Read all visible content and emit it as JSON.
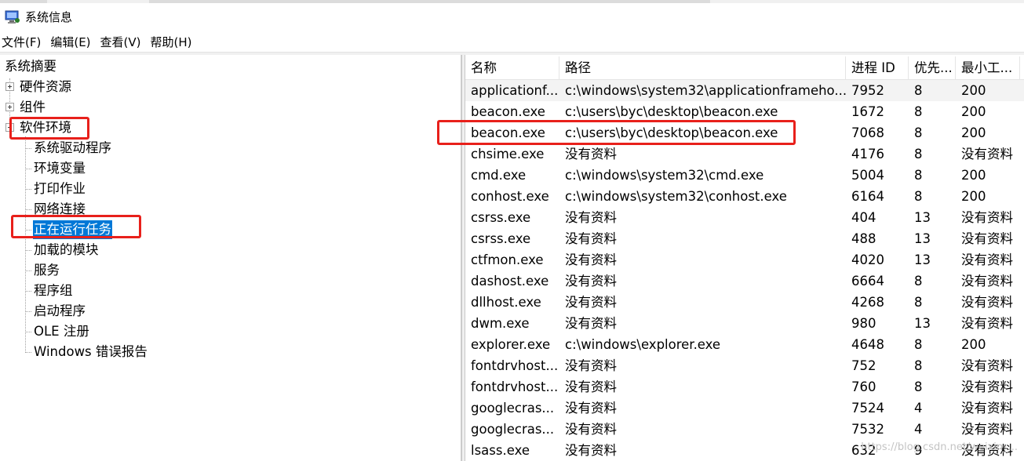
{
  "window": {
    "title": "系统信息",
    "app_icon": "system-info-icon"
  },
  "menu": [
    "文件(F)",
    "编辑(E)",
    "查看(V)",
    "帮助(H)"
  ],
  "tree": {
    "root": "系统摘要",
    "items": [
      {
        "label": "硬件资源",
        "expandable": true
      },
      {
        "label": "组件",
        "expandable": true
      },
      {
        "label": "软件环境",
        "expandable": true
      }
    ],
    "software_children": [
      "系统驱动程序",
      "环境变量",
      "打印作业",
      "网络连接",
      "正在运行任务",
      "加载的模块",
      "服务",
      "程序组",
      "启动程序",
      "OLE 注册",
      "Windows 错误报告"
    ],
    "selected": "正在运行任务"
  },
  "table": {
    "columns": [
      "名称",
      "路径",
      "进程 ID",
      "优先...",
      "最小工..."
    ],
    "rows": [
      [
        "applicationf...",
        "c:\\windows\\system32\\applicationframeho...",
        "7952",
        "8",
        "200"
      ],
      [
        "beacon.exe",
        "c:\\users\\byc\\desktop\\beacon.exe",
        "1672",
        "8",
        "200"
      ],
      [
        "beacon.exe",
        "c:\\users\\byc\\desktop\\beacon.exe",
        "7068",
        "8",
        "200"
      ],
      [
        "chsime.exe",
        "没有资料",
        "4176",
        "8",
        "没有资料"
      ],
      [
        "cmd.exe",
        "c:\\windows\\system32\\cmd.exe",
        "5004",
        "8",
        "200"
      ],
      [
        "conhost.exe",
        "c:\\windows\\system32\\conhost.exe",
        "6164",
        "8",
        "200"
      ],
      [
        "csrss.exe",
        "没有资料",
        "404",
        "13",
        "没有资料"
      ],
      [
        "csrss.exe",
        "没有资料",
        "488",
        "13",
        "没有资料"
      ],
      [
        "ctfmon.exe",
        "没有资料",
        "4020",
        "13",
        "没有资料"
      ],
      [
        "dashost.exe",
        "没有资料",
        "6664",
        "8",
        "没有资料"
      ],
      [
        "dllhost.exe",
        "没有资料",
        "4268",
        "8",
        "没有资料"
      ],
      [
        "dwm.exe",
        "没有资料",
        "980",
        "13",
        "没有资料"
      ],
      [
        "explorer.exe",
        "c:\\windows\\explorer.exe",
        "4648",
        "8",
        "200"
      ],
      [
        "fontdrvhost....",
        "没有资料",
        "752",
        "8",
        "没有资料"
      ],
      [
        "fontdrvhost....",
        "没有资料",
        "760",
        "8",
        "没有资料"
      ],
      [
        "googlecras...",
        "没有资料",
        "7524",
        "4",
        "没有资料"
      ],
      [
        "googlecras...",
        "没有资料",
        "7532",
        "4",
        "没有资料"
      ],
      [
        "lsass.exe",
        "没有资料",
        "632",
        "9",
        "没有资料"
      ]
    ]
  },
  "watermark": "https://blog.csdn.net/weixin_...",
  "colors": {
    "selection": "#0078d7",
    "highlight_box": "#e8201b"
  }
}
